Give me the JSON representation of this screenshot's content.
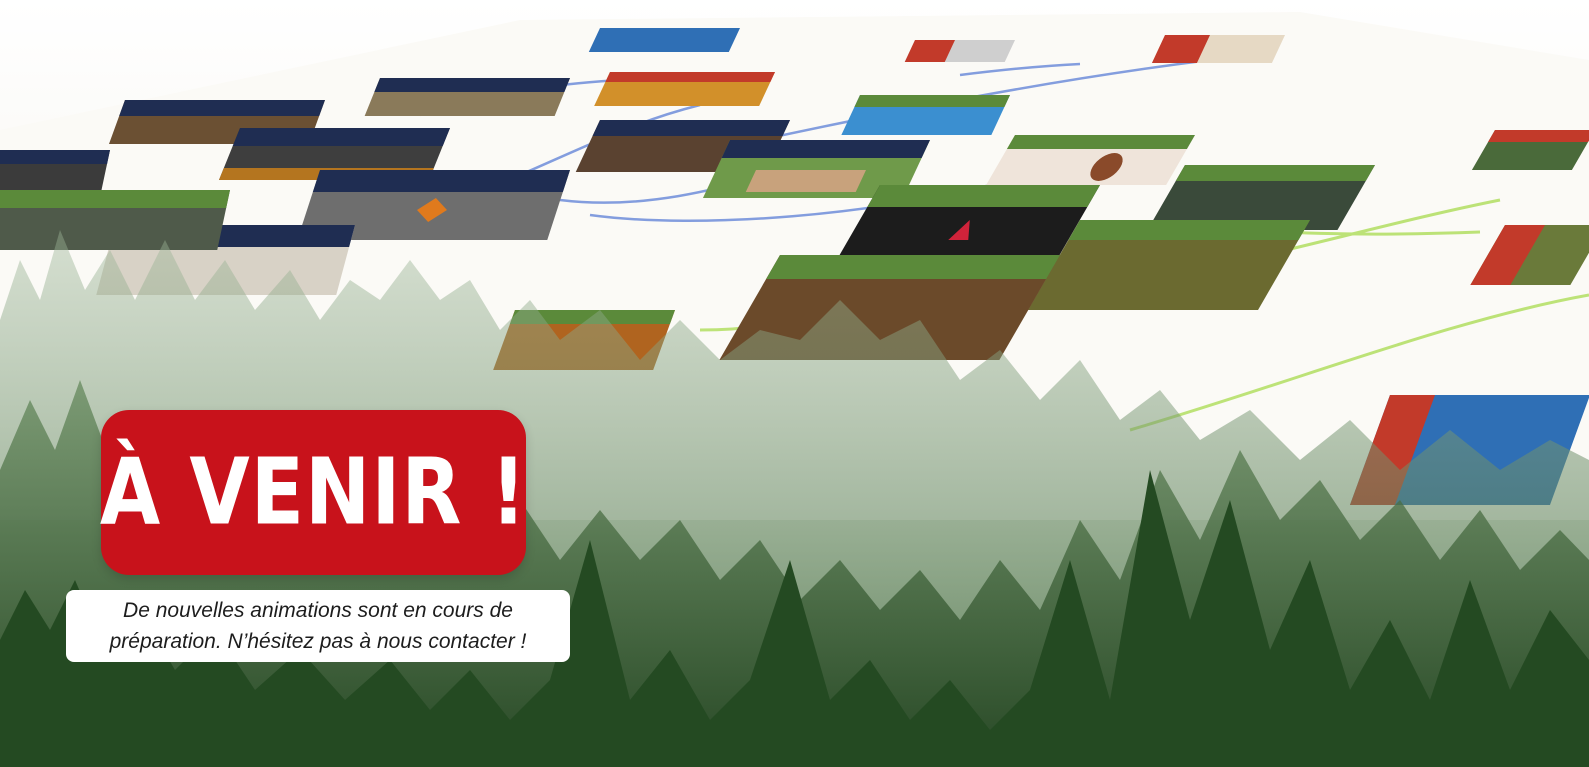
{
  "banner": {
    "headline": "À VENIR !",
    "description_line1": "De nouvelles animations sont en cours de",
    "description_line2": "préparation. N’hésitez pas à nous contacter !",
    "badge_color": "#c8121b",
    "caption_background": "#ffffff"
  },
  "scene": {
    "board_card_header_colors": [
      "#1f2d52",
      "#5b8a3a",
      "#c23a2a",
      "#2f6fb5"
    ],
    "forest_color": "#2f5a2c"
  }
}
